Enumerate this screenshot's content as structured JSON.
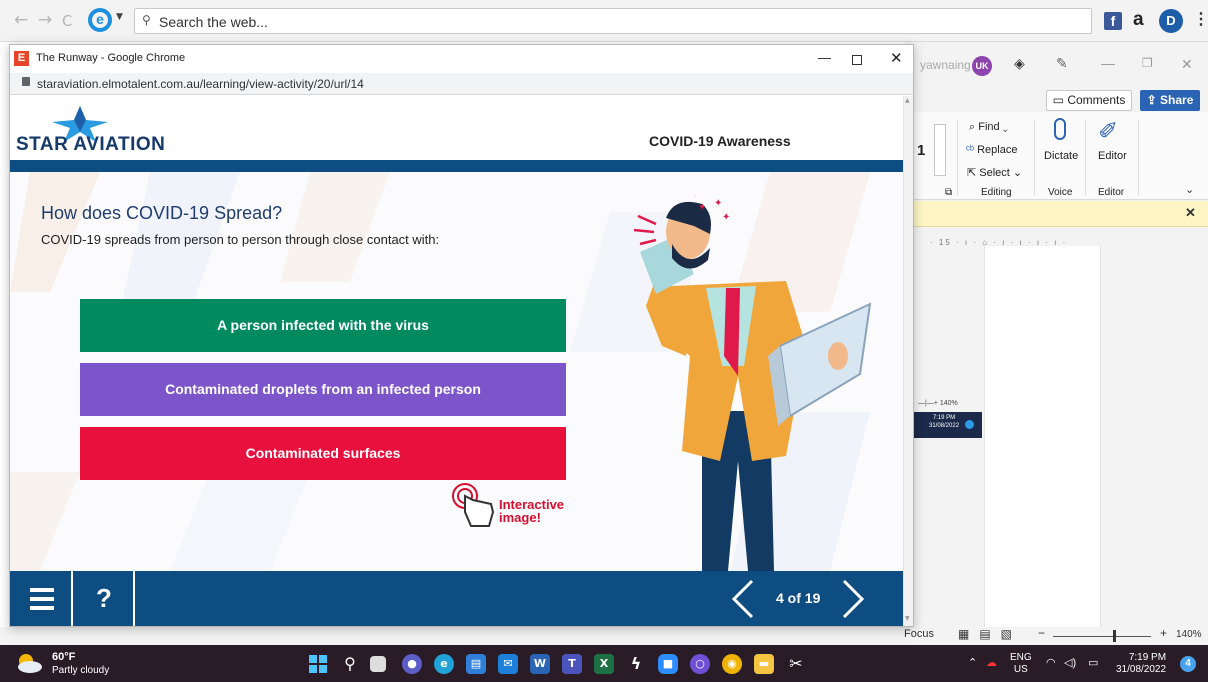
{
  "browser": {
    "back": "←",
    "forward": "→",
    "refresh": "C",
    "search_placeholder": "Search the web..."
  },
  "word": {
    "user": "yawnaing",
    "avatar": "UK",
    "comments": "Comments",
    "share": "Share",
    "font_size": "1",
    "find": "Find",
    "replace": "Replace",
    "select": "Select",
    "dictate": "Dictate",
    "editor": "Editor",
    "group_editing": "Editing",
    "group_voice": "Voice",
    "group_editor": "Editor",
    "ruler": "· 15 · ı · ⌂ · ı · ı · ı · ı ·",
    "focus": "Focus",
    "zoom": "140%",
    "thumb_zoom": "140%",
    "thumb_time": "7:19 PM",
    "thumb_date": "31/08/2022"
  },
  "popup": {
    "favicon": "E",
    "window_title": "The Runway - Google Chrome",
    "url": "staraviation.elmotalent.com.au/learning/view-activity/20/url/14"
  },
  "course": {
    "logo": "STAR AVIATION",
    "title": "COVID-19 Awareness",
    "question": "How does COVID-19 Spread?",
    "subtitle": "COVID-19 spreads from person to person through close contact with:",
    "options": [
      "A person infected with the virus",
      "Contaminated droplets from an infected person",
      "Contaminated surfaces"
    ],
    "interactive_line1": "Interactive",
    "interactive_line2": "image!",
    "help": "?",
    "page_count": "4 of 19",
    "colors": {
      "navy": "#0e4d82",
      "green": "#008a5e",
      "purple": "#7b55c9",
      "red": "#e8113e"
    }
  },
  "taskbar": {
    "temp": "60°F",
    "condition": "Partly cloudy",
    "lang1": "ENG",
    "lang2": "US",
    "time": "7:19 PM",
    "date": "31/08/2022",
    "badge": "4",
    "apps": [
      "windows-start-icon",
      "search-icon",
      "task-view-icon",
      "chat-icon",
      "edge-icon",
      "store-icon",
      "mail-icon",
      "word-icon",
      "teams-icon",
      "excel-icon",
      "app-icon",
      "zoom-icon",
      "circle-app-icon",
      "chrome-icon",
      "file-explorer-icon",
      "snip-icon"
    ]
  }
}
